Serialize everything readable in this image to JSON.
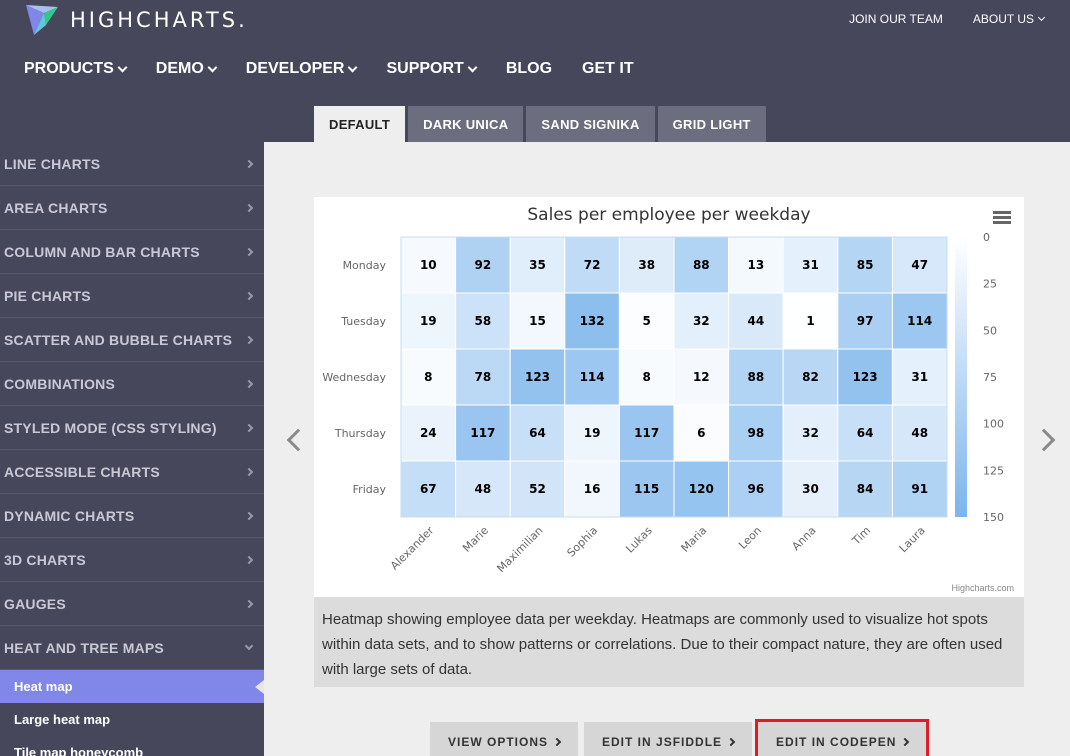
{
  "header": {
    "brand": "HIGHCHARTS.",
    "top_links": [
      "JOIN OUR TEAM",
      "ABOUT US"
    ],
    "nav": [
      {
        "label": "PRODUCTS",
        "dropdown": true
      },
      {
        "label": "DEMO",
        "dropdown": true
      },
      {
        "label": "DEVELOPER",
        "dropdown": true
      },
      {
        "label": "SUPPORT",
        "dropdown": true
      },
      {
        "label": "BLOG",
        "dropdown": false
      },
      {
        "label": "GET IT",
        "dropdown": false
      }
    ]
  },
  "theme_tabs": [
    "DEFAULT",
    "DARK UNICA",
    "SAND SIGNIKA",
    "GRID LIGHT"
  ],
  "active_theme": "DEFAULT",
  "sidebar": {
    "items": [
      "LINE CHARTS",
      "AREA CHARTS",
      "COLUMN AND BAR CHARTS",
      "PIE CHARTS",
      "SCATTER AND BUBBLE CHARTS",
      "COMBINATIONS",
      "STYLED MODE (CSS STYLING)",
      "ACCESSIBLE CHARTS",
      "DYNAMIC CHARTS",
      "3D CHARTS",
      "GAUGES",
      "HEAT AND TREE MAPS"
    ],
    "sub_items": [
      "Heat map",
      "Large heat map",
      "Tile map honeycomb"
    ],
    "active_sub": "Heat map"
  },
  "chart_data": {
    "type": "heatmap",
    "title": "Sales per employee per weekday",
    "x_categories": [
      "Alexander",
      "Marie",
      "Maximilian",
      "Sophia",
      "Lukas",
      "Maria",
      "Leon",
      "Anna",
      "Tim",
      "Laura"
    ],
    "y_categories": [
      "Monday",
      "Tuesday",
      "Wednesday",
      "Thursday",
      "Friday"
    ],
    "values": [
      [
        10,
        92,
        35,
        72,
        38,
        88,
        13,
        31,
        85,
        47
      ],
      [
        19,
        58,
        15,
        132,
        5,
        32,
        44,
        1,
        97,
        114
      ],
      [
        8,
        78,
        123,
        114,
        8,
        12,
        88,
        82,
        123,
        31
      ],
      [
        24,
        117,
        64,
        19,
        117,
        6,
        98,
        32,
        64,
        48
      ],
      [
        67,
        48,
        52,
        16,
        115,
        120,
        96,
        30,
        84,
        91
      ]
    ],
    "colorAxis": {
      "min": 0,
      "max": 150,
      "minColor": "#FFFFFF",
      "maxColor": "#7cb5ec",
      "ticks": [
        0,
        25,
        50,
        75,
        100,
        125,
        150
      ]
    },
    "credits": "Highcharts.com"
  },
  "description": "Heatmap showing employee data per weekday. Heatmaps are commonly used to visualize hot spots within data sets, and to show patterns or correlations. Due to their compact nature, they are often used with large sets of data.",
  "buttons": [
    "VIEW OPTIONS",
    "EDIT IN JSFIDDLE",
    "EDIT IN CODEPEN"
  ],
  "highlighted_button": "EDIT IN CODEPEN"
}
